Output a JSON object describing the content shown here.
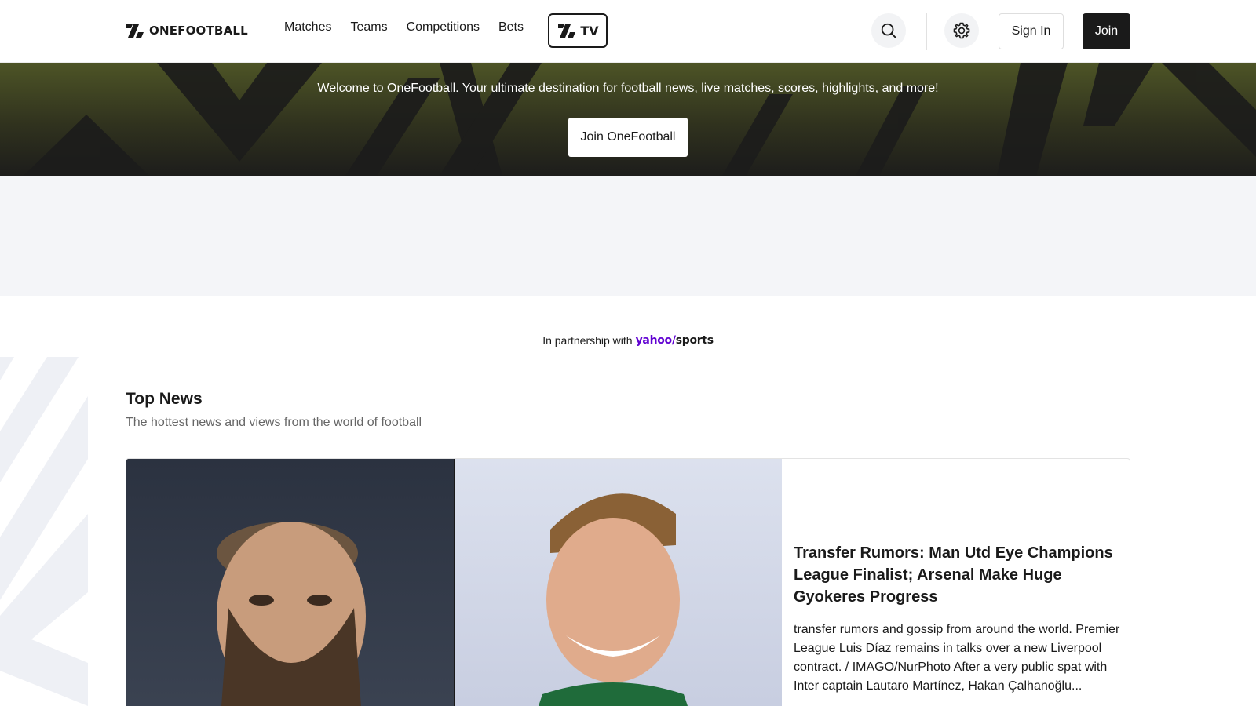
{
  "header": {
    "logo_text": "ONEFOOTBALL",
    "nav": [
      "Matches",
      "Teams",
      "Competitions",
      "Bets"
    ],
    "tv_label": "TV",
    "sign_in_label": "Sign In",
    "join_label": "Join",
    "icons": [
      "search-icon",
      "settings-gear-icon"
    ]
  },
  "hero": {
    "welcome_text": "Welcome to OneFootball. Your ultimate destination for football news, live matches, scores, highlights, and more!",
    "cta_label": "Join OneFootball"
  },
  "partnership": {
    "prefix": "In partnership with",
    "brand_yahoo": "yahoo/",
    "brand_sports": "sports"
  },
  "top_news": {
    "title": "Top News",
    "subtitle": "The hottest news and views from the world of football",
    "featured": {
      "headline": "Transfer Rumors: Man Utd Eye Champions League Finalist; Arsenal Make Huge Gyokeres Progress",
      "excerpt": "transfer rumors and gossip from around the world. Premier League Luis Díaz remains in talks over a new Liverpool contract. / IMAGO/NurPhoto After a very public spat with Inter captain Lautaro Martínez, Hakan Çalhanoğlu..."
    }
  },
  "colors": {
    "brand_dark": "#1a1a1a",
    "hero_top": "#4d5426",
    "yahoo_purple": "#6001d2",
    "ad_band": "#f4f5f8"
  }
}
